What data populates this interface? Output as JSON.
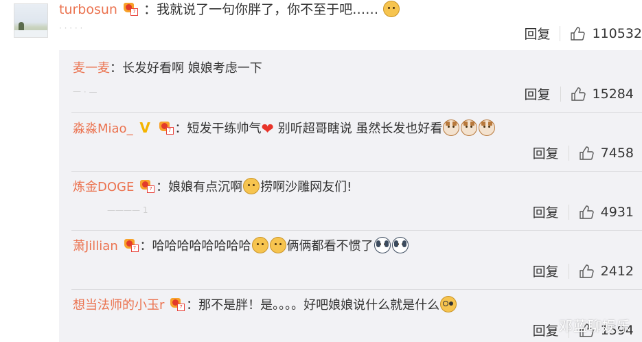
{
  "top_comment": {
    "username": "turbosun",
    "separator": "：",
    "text": "我就说了一句你胖了，你不至于吧……",
    "emoji_after": "doge-emoji",
    "actions": {
      "reply": "回复",
      "likes": "110532"
    }
  },
  "replies": [
    {
      "username": "麦一麦",
      "sep": "：",
      "text": "长发好看啊 娘娘考虑一下",
      "likes": "15284",
      "reply": "回复"
    },
    {
      "username": "淼淼Miao_",
      "sep": "：",
      "text1": "短发干练帅气",
      "text2": "别听超哥瞎说 虽然长发也好看",
      "likes": "7458",
      "reply": "回复"
    },
    {
      "username": "炼金DOGE",
      "sep": "：",
      "text1": "娘娘有点沉啊",
      "text2": "捞啊沙雕网友们!",
      "likes": "4931",
      "reply": "回复"
    },
    {
      "username": "萧Jillian",
      "sep": "：",
      "text1": "哈哈哈哈哈哈哈哈",
      "text2": "俩俩都看不惯了",
      "likes": "2412",
      "reply": "回复"
    },
    {
      "username": "想当法师的小玉r",
      "sep": "：",
      "text": "那不是胖！是。。。。好吧娘娘说什么就是什么",
      "likes": "1594",
      "reply": "回复"
    }
  ],
  "watermark": "邓蓝聊娱乐",
  "colors": {
    "username": "#eb7350",
    "reply_bg": "#f2f2f5",
    "text": "#333333"
  }
}
